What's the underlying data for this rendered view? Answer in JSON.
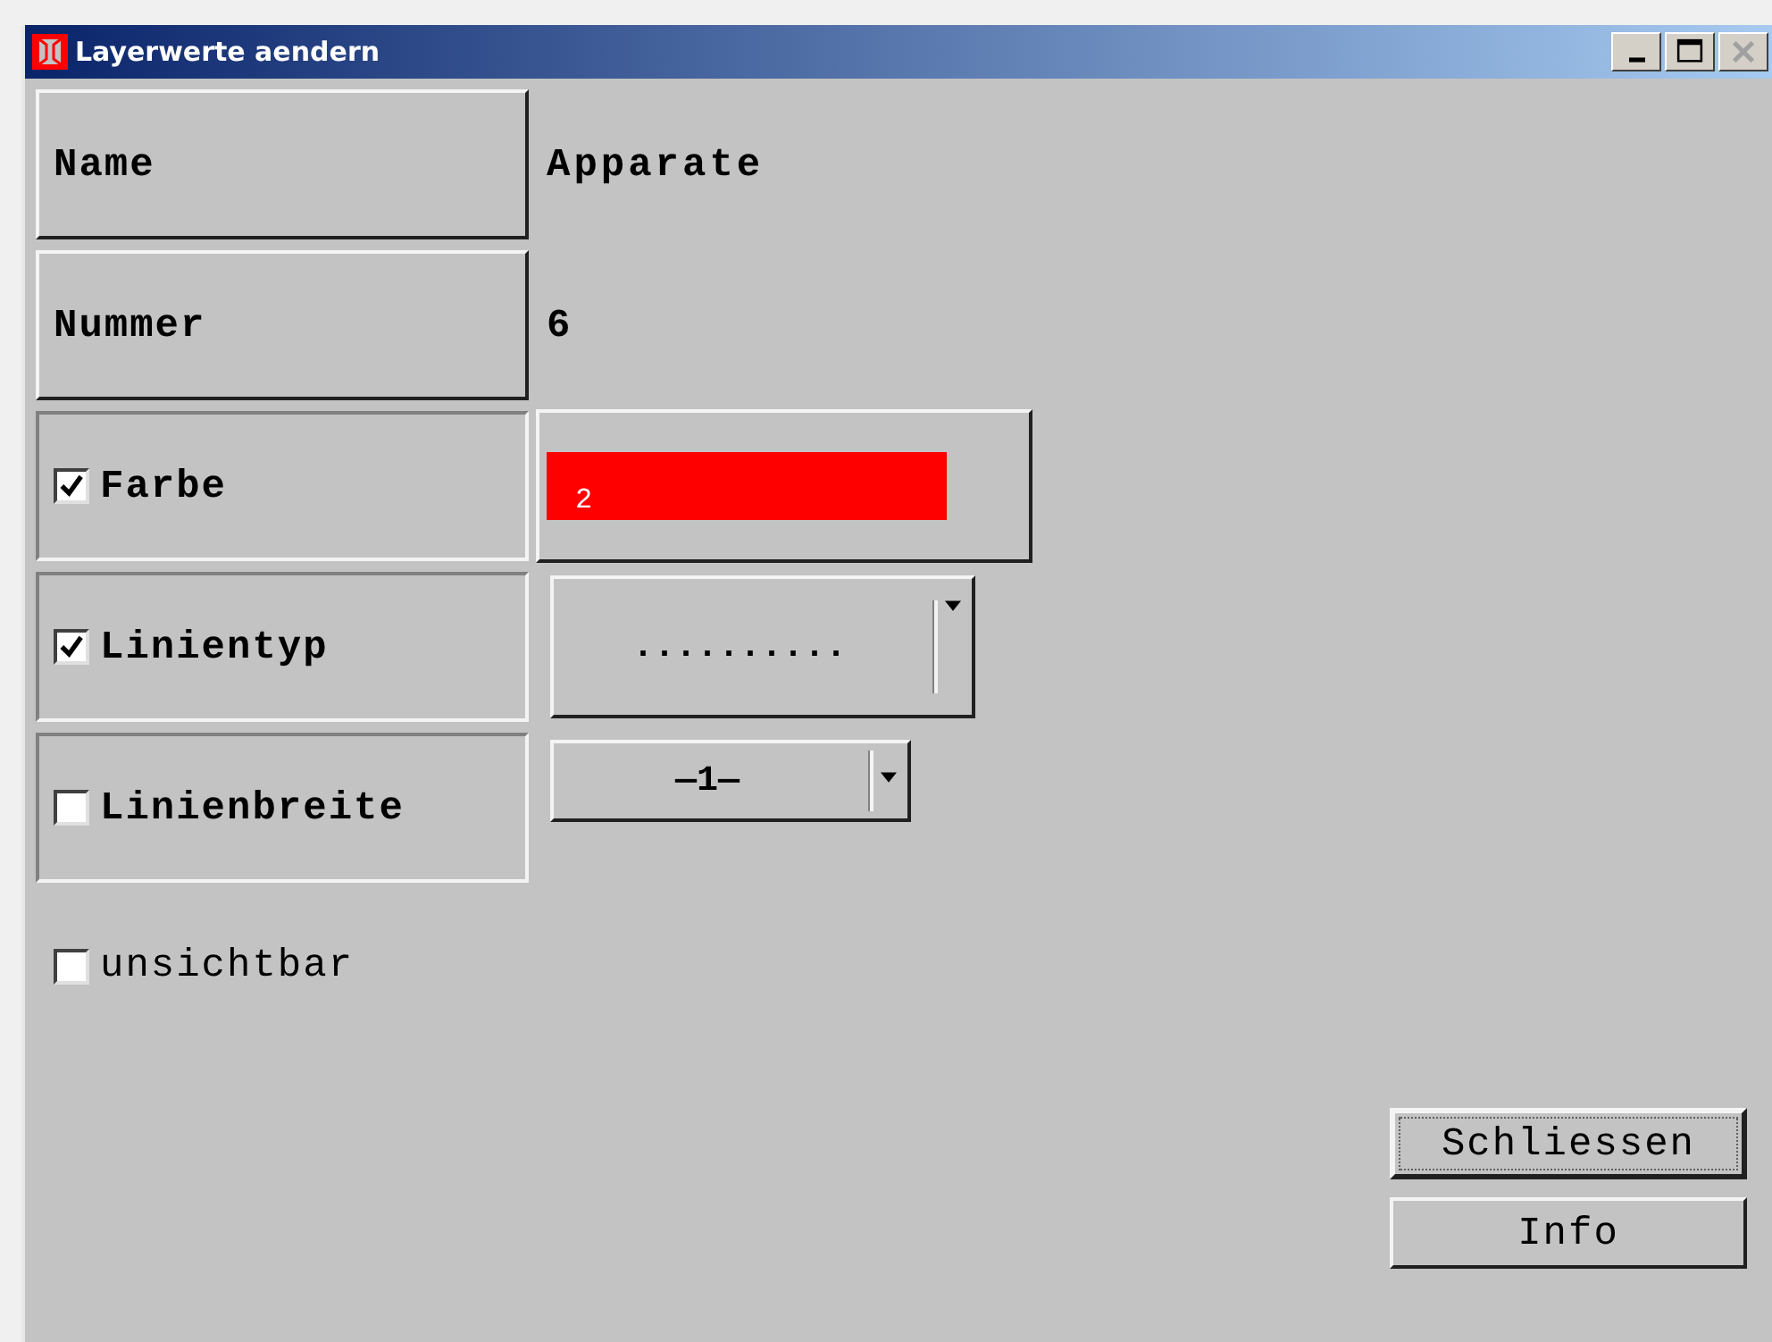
{
  "window": {
    "title": "Layerwerte aendern",
    "controls": [
      {
        "kind": "minimize",
        "disabled": false
      },
      {
        "kind": "maximize",
        "disabled": false
      },
      {
        "kind": "close",
        "disabled": true
      }
    ]
  },
  "rows": [
    {
      "kind": "text",
      "label": "Name",
      "value": "Apparate"
    },
    {
      "kind": "text",
      "label": "Nummer",
      "value": "6"
    },
    {
      "kind": "color",
      "label": "Farbe",
      "checked": true,
      "color": "#ff0000",
      "value": "2"
    },
    {
      "kind": "dropdown",
      "label": "Linientyp",
      "checked": true,
      "value": ".........."
    },
    {
      "kind": "dropdown",
      "label": "Linienbreite",
      "checked": false,
      "value": "—1—"
    }
  ],
  "invisible": {
    "label": "unsichtbar",
    "checked": false
  },
  "buttons": [
    {
      "label": "Schliessen",
      "focused": true
    },
    {
      "label": "Info",
      "focused": false
    }
  ]
}
